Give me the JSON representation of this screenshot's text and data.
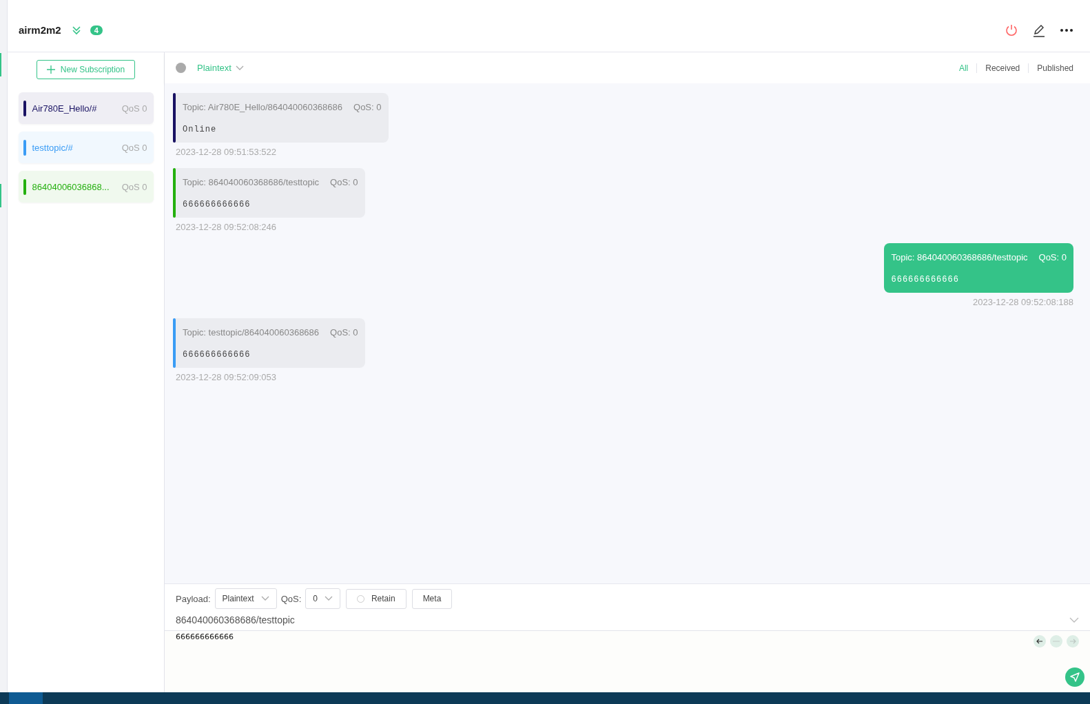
{
  "connection": {
    "name": "airm2m2",
    "badge": "4"
  },
  "subscription_panel": {
    "new_button": "New Subscription",
    "items": [
      {
        "topic": "Air780E_Hello/#",
        "qos": "QoS 0",
        "color": "#1a1363"
      },
      {
        "topic": "testtopic/#",
        "qos": "QoS 0",
        "color": "#3a9cf5"
      },
      {
        "topic": "86404006036868...",
        "qos": "QoS 0",
        "color": "#25b00f"
      }
    ]
  },
  "toolbar": {
    "payload_type": "Plaintext",
    "filters": [
      {
        "label": "All",
        "selected": true
      },
      {
        "label": "Received",
        "selected": false
      },
      {
        "label": "Published",
        "selected": false
      }
    ]
  },
  "messages": [
    {
      "kind": "received",
      "topic": "Topic: Air780E_Hello/864040060368686",
      "qos": "QoS: 0",
      "payload": "Online",
      "time": "2023-12-28 09:51:53:522",
      "color": "#1a1363"
    },
    {
      "kind": "received",
      "topic": "Topic: 864040060368686/testtopic",
      "qos": "QoS: 0",
      "payload": "666666666666",
      "time": "2023-12-28 09:52:08:246",
      "color": "#25b00f"
    },
    {
      "kind": "published",
      "topic": "Topic: 864040060368686/testtopic",
      "qos": "QoS: 0",
      "payload": "666666666666",
      "time": "2023-12-28 09:52:08:188"
    },
    {
      "kind": "received",
      "topic": "Topic: testtopic/864040060368686",
      "qos": "QoS: 0",
      "payload": "666666666666",
      "time": "2023-12-28 09:52:09:053",
      "color": "#3a9cf5"
    }
  ],
  "composer": {
    "payload_label": "Payload:",
    "payload_format": "Plaintext",
    "qos_label": "QoS:",
    "qos": "0",
    "retain": {
      "label": "Retain",
      "checked": false
    },
    "meta_button": "Meta",
    "topic": "864040060368686/testtopic",
    "payload": "666666666666"
  }
}
